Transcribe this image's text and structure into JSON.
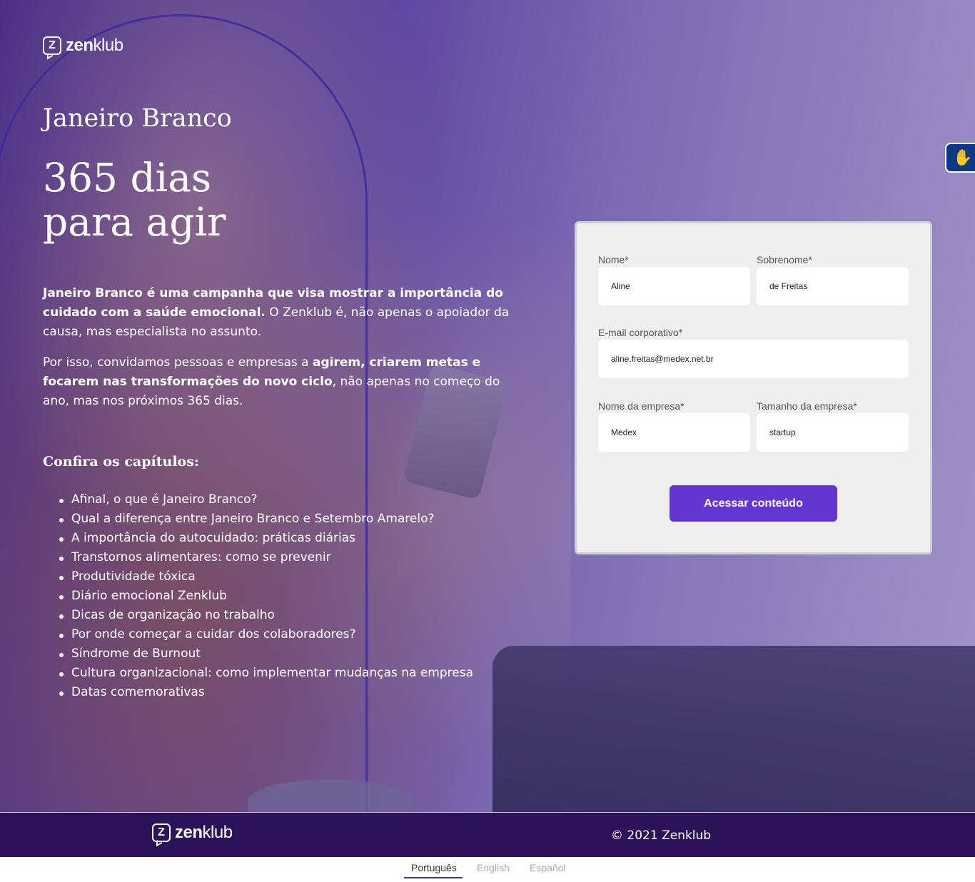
{
  "brand": {
    "logo_letter": "Z",
    "name_bold": "zen",
    "name_light": "klub"
  },
  "hero": {
    "campaign_title": "Janeiro Branco",
    "headline_line1": "365 dias",
    "headline_line2": "para agir",
    "intro_p1_bold": "Janeiro Branco é uma campanha que visa mostrar a importância do cuidado com a saúde emocional.",
    "intro_p1_rest": " O Zenklub é, não apenas o apoiador da causa, mas especialista no assunto.",
    "intro_p2_start": "Por isso, convidamos pessoas e empresas a ",
    "intro_p2_bold": "agirem, criarem metas e focarem nas transformações do novo ciclo",
    "intro_p2_end": ", não apenas no começo do ano, mas nos próximos 365 dias.",
    "chapters_title": "Confira os capítulos:",
    "chapters": [
      "Afinal, o que é Janeiro Branco?",
      "Qual a diferença entre Janeiro Branco e Setembro Amarelo?",
      "A importância do autocuidado: práticas diárias",
      "Transtornos alimentares: como se prevenir",
      "Produtividade tóxica",
      "Diário emocional Zenklub",
      "Dicas de organização no trabalho",
      "Por onde começar a cuidar dos colaboradores?",
      "Síndrome de Burnout",
      "Cultura organizacional: como implementar mudanças na empresa",
      "Datas comemorativas"
    ]
  },
  "accessibility": {
    "icon": "sign-language-hands-icon"
  },
  "form": {
    "first_name": {
      "label": "Nome*",
      "value": "Aline"
    },
    "last_name": {
      "label": "Sobrenome*",
      "value": "de Freitas"
    },
    "email": {
      "label": "E-mail corporativo*",
      "value": "aline.freitas@medex.net.br"
    },
    "company": {
      "label": "Nome da empresa*",
      "value": "Medex"
    },
    "company_size": {
      "label": "Tamanho da empresa*",
      "value": "startup"
    },
    "submit_label": "Acessar conteúdo"
  },
  "footer": {
    "copyright": "© 2021 Zenklub"
  },
  "languages": {
    "items": [
      "Português",
      "English",
      "Español"
    ],
    "active": "Português"
  },
  "colors": {
    "primary_button": "#6236d1",
    "footer_bg": "#2c1359",
    "accessibility_bg": "#0a3a86",
    "card_bg": "#efefef"
  }
}
